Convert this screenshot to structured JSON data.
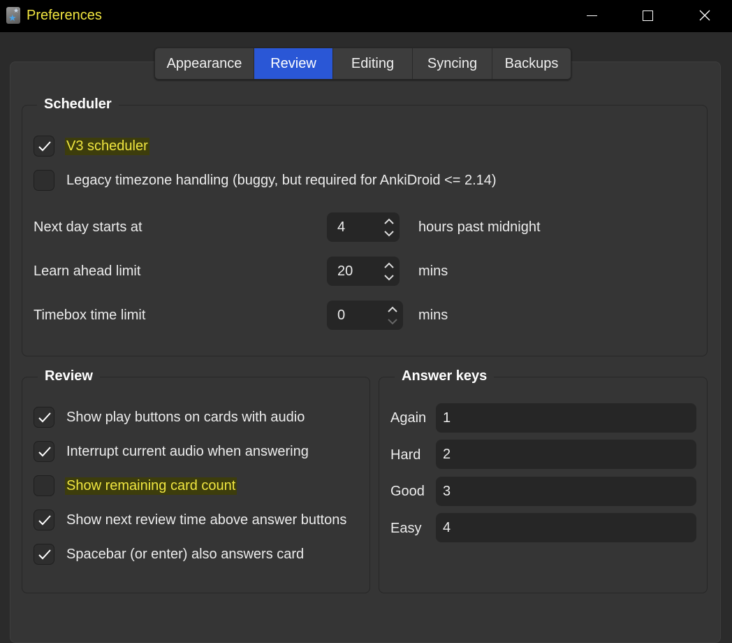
{
  "window": {
    "title": "Preferences",
    "controls": [
      "minimize",
      "maximize",
      "close"
    ]
  },
  "tabs": [
    {
      "label": "Appearance",
      "active": false
    },
    {
      "label": "Review",
      "active": true
    },
    {
      "label": "Editing",
      "active": false
    },
    {
      "label": "Syncing",
      "active": false
    },
    {
      "label": "Backups",
      "active": false
    }
  ],
  "scheduler": {
    "title": "Scheduler",
    "options": [
      {
        "label": "V3 scheduler",
        "checked": true,
        "highlighted": true
      },
      {
        "label": "Legacy timezone handling (buggy, but required for AnkiDroid <= 2.14)",
        "checked": false,
        "highlighted": false
      }
    ],
    "fields": [
      {
        "label": "Next day starts at",
        "value": "4",
        "unit": "hours past midnight"
      },
      {
        "label": "Learn ahead limit",
        "value": "20",
        "unit": "mins"
      },
      {
        "label": "Timebox time limit",
        "value": "0",
        "unit": "mins"
      }
    ]
  },
  "review": {
    "title": "Review",
    "options": [
      {
        "label": "Show play buttons on cards with audio",
        "checked": true,
        "highlighted": false
      },
      {
        "label": "Interrupt current audio when answering",
        "checked": true,
        "highlighted": false
      },
      {
        "label": "Show remaining card count",
        "checked": false,
        "highlighted": true
      },
      {
        "label": "Show next review time above answer buttons",
        "checked": true,
        "highlighted": false
      },
      {
        "label": "Spacebar (or enter) also answers card",
        "checked": true,
        "highlighted": false
      }
    ]
  },
  "answer_keys": {
    "title": "Answer keys",
    "keys": [
      {
        "label": "Again",
        "value": "1"
      },
      {
        "label": "Hard",
        "value": "2"
      },
      {
        "label": "Good",
        "value": "3"
      },
      {
        "label": "Easy",
        "value": "4"
      }
    ]
  },
  "colors": {
    "accent": "#2a57d6",
    "title_text": "#f2e640",
    "highlight_bg": "#3d3d0c"
  }
}
